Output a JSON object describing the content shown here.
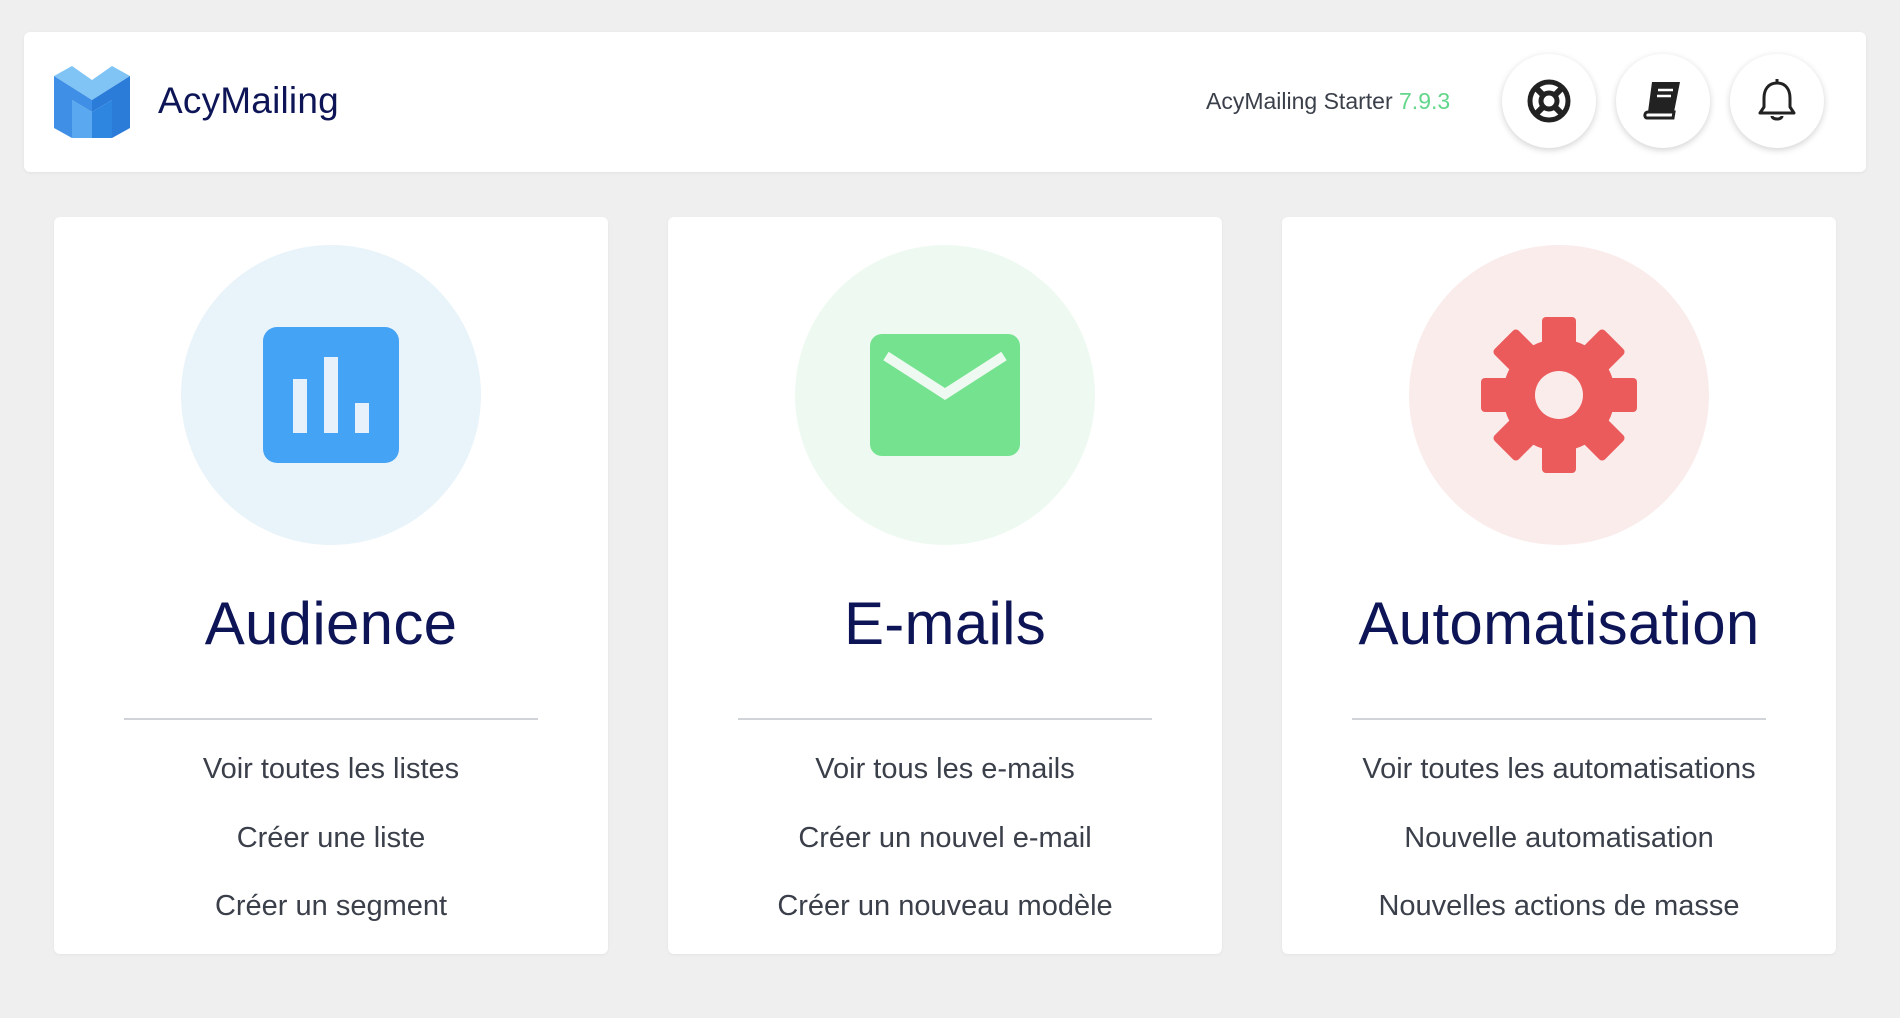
{
  "header": {
    "brand_name": "AcyMailing",
    "version_prefix": "AcyMailing Starter",
    "version_number": "7.9.3",
    "buttons": [
      {
        "icon": "support-lifebuoy-icon"
      },
      {
        "icon": "documentation-book-icon"
      },
      {
        "icon": "notifications-bell-icon"
      }
    ]
  },
  "colors": {
    "brand_navy": "#0d1557",
    "version_green": "#62d68a",
    "audience_blue": "#45a3f5",
    "emails_green": "#74e28f",
    "automation_red": "#ec5b5b"
  },
  "cards": [
    {
      "title": "Audience",
      "icon": "bar-chart-icon",
      "links": [
        "Voir toutes les listes",
        "Créer une liste",
        "Créer un segment"
      ]
    },
    {
      "title": "E-mails",
      "icon": "envelope-icon",
      "links": [
        "Voir tous les e-mails",
        "Créer un nouvel e-mail",
        "Créer un nouveau modèle"
      ]
    },
    {
      "title": "Automatisation",
      "icon": "gear-icon",
      "links": [
        "Voir toutes les automatisations",
        "Nouvelle automatisation",
        "Nouvelles actions de masse"
      ]
    }
  ]
}
